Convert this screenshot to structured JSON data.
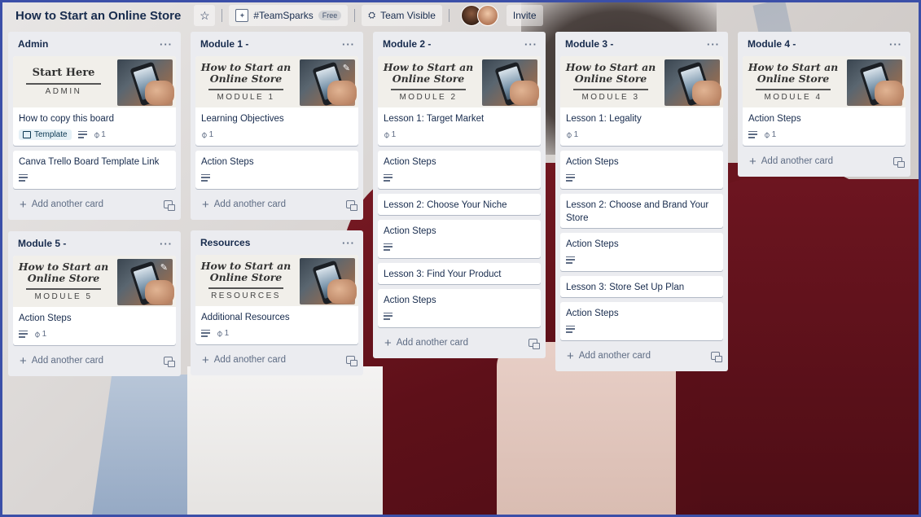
{
  "board": {
    "title": "How to Start an Online Store",
    "team_name": "#TeamSparks",
    "free_badge": "Free",
    "visibility": "Team Visible",
    "invite_label": "Invite"
  },
  "icons": {
    "star": "star-icon",
    "team": "team-icon",
    "visibility": "team-visible-icon",
    "description": "description-icon",
    "attachment": "paperclip-icon",
    "template": "template-icon",
    "add": "plus-icon",
    "create_from_template": "create-from-template-icon",
    "menu": "ellipsis-icon",
    "edit": "pencil-icon"
  },
  "common": {
    "add_card_label": "Add another card",
    "add_plus": "+",
    "menu_label": "···",
    "attach_count": "1",
    "template_label": "Template"
  },
  "covers": {
    "script_line1": "How to Start an",
    "script_line2": "Online Store",
    "start_here": "Start Here",
    "admin": "ADMIN",
    "module_1": "MODULE 1",
    "module_2": "MODULE 2",
    "module_3": "MODULE 3",
    "module_4": "MODULE 4",
    "module_5": "MODULE 5",
    "resources": "RESOURCES"
  },
  "lists": {
    "admin": {
      "title": "Admin",
      "cards": [
        {
          "title": "How to copy this board"
        },
        {
          "title": "Canva Trello Board Template Link"
        }
      ]
    },
    "module1": {
      "title": "Module 1 -",
      "cards": [
        {
          "title": "Learning Objectives"
        },
        {
          "title": "Action Steps"
        }
      ]
    },
    "module2": {
      "title": "Module 2 -",
      "cards": [
        {
          "title": "Lesson 1: Target Market"
        },
        {
          "title": "Action Steps"
        },
        {
          "title": "Lesson 2: Choose Your Niche"
        },
        {
          "title": "Action Steps"
        },
        {
          "title": "Lesson 3: Find Your Product"
        },
        {
          "title": "Action Steps"
        }
      ]
    },
    "module3": {
      "title": "Module 3 -",
      "cards": [
        {
          "title": "Lesson 1: Legality"
        },
        {
          "title": "Action Steps"
        },
        {
          "title": "Lesson 2: Choose and Brand Your Store"
        },
        {
          "title": "Action Steps"
        },
        {
          "title": "Lesson 3: Store Set Up Plan"
        },
        {
          "title": "Action Steps"
        }
      ]
    },
    "module4": {
      "title": "Module 4 -",
      "cards": [
        {
          "title": "Action Steps"
        }
      ]
    },
    "module5": {
      "title": "Module 5 -",
      "cards": [
        {
          "title": "Action Steps"
        }
      ]
    },
    "resources": {
      "title": "Resources",
      "cards": [
        {
          "title": "Additional Resources"
        }
      ]
    }
  }
}
